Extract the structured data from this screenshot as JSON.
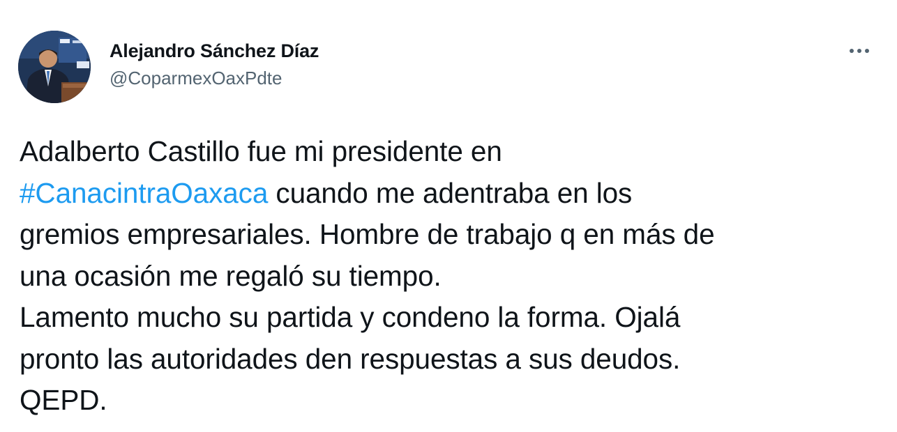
{
  "author": {
    "display_name": "Alejandro Sánchez Díaz",
    "handle": "@CoparmexOaxPdte",
    "avatar_icon": "profile-photo"
  },
  "menu": {
    "icon": "more-horizontal-icon"
  },
  "tweet": {
    "line1": "Adalberto Castillo fue mi presidente en",
    "hashtag": "#CanacintraOaxaca",
    "line2_rest": " cuando me adentraba en los",
    "line3": "gremios empresariales. Hombre de trabajo q en más de",
    "line4": "una ocasión me regaló su tiempo.",
    "line5": "Lamento mucho su partida y condeno la forma. Ojalá",
    "line6": "pronto las autoridades den respuestas a sus deudos.",
    "line7": "QEPD."
  },
  "colors": {
    "text": "#0f1419",
    "secondary": "#536471",
    "link": "#1d9bf0"
  }
}
